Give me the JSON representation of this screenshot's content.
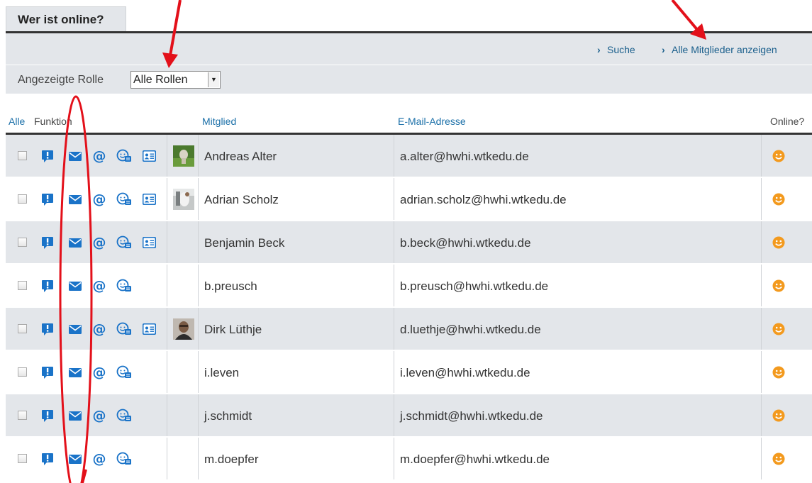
{
  "tab": {
    "title": "Wer ist online?"
  },
  "actions": {
    "search": "Suche",
    "show_all": "Alle Mitglieder anzeigen"
  },
  "filter": {
    "label": "Angezeigte Rolle",
    "selected": "Alle Rollen"
  },
  "table": {
    "headers": {
      "all": "Alle",
      "function": "Funktion",
      "member": "Mitglied",
      "email": "E-Mail-Adresse",
      "online": "Online?"
    },
    "rows": [
      {
        "name": "Andreas Alter",
        "email": "a.alter@hwhi.wtkedu.de",
        "has_card": true,
        "avatar": "photo-green"
      },
      {
        "name": "Adrian Scholz",
        "email": "adrian.scholz@hwhi.wtkedu.de",
        "has_card": true,
        "avatar": "photo-light"
      },
      {
        "name": "Benjamin Beck",
        "email": "b.beck@hwhi.wtkedu.de",
        "has_card": true,
        "avatar": ""
      },
      {
        "name": "b.preusch",
        "email": "b.preusch@hwhi.wtkedu.de",
        "has_card": false,
        "avatar": ""
      },
      {
        "name": "Dirk Lüthje",
        "email": "d.luethje@hwhi.wtkedu.de",
        "has_card": true,
        "avatar": "photo-portrait"
      },
      {
        "name": "i.leven",
        "email": "i.leven@hwhi.wtkedu.de",
        "has_card": false,
        "avatar": ""
      },
      {
        "name": "j.schmidt",
        "email": "j.schmidt@hwhi.wtkedu.de",
        "has_card": false,
        "avatar": ""
      },
      {
        "name": "m.doepfer",
        "email": "m.doepfer@hwhi.wtkedu.de",
        "has_card": false,
        "avatar": ""
      }
    ]
  },
  "colors": {
    "icon_blue": "#1a73c8",
    "online_orange": "#f39a1e",
    "annotation_red": "#e3101a",
    "link_blue": "#1a6fa8"
  },
  "icons": [
    "alert-icon",
    "mail-icon",
    "at-icon",
    "chat-icon",
    "contact-card-icon",
    "online-smiley-icon",
    "chevron-right-icon"
  ]
}
